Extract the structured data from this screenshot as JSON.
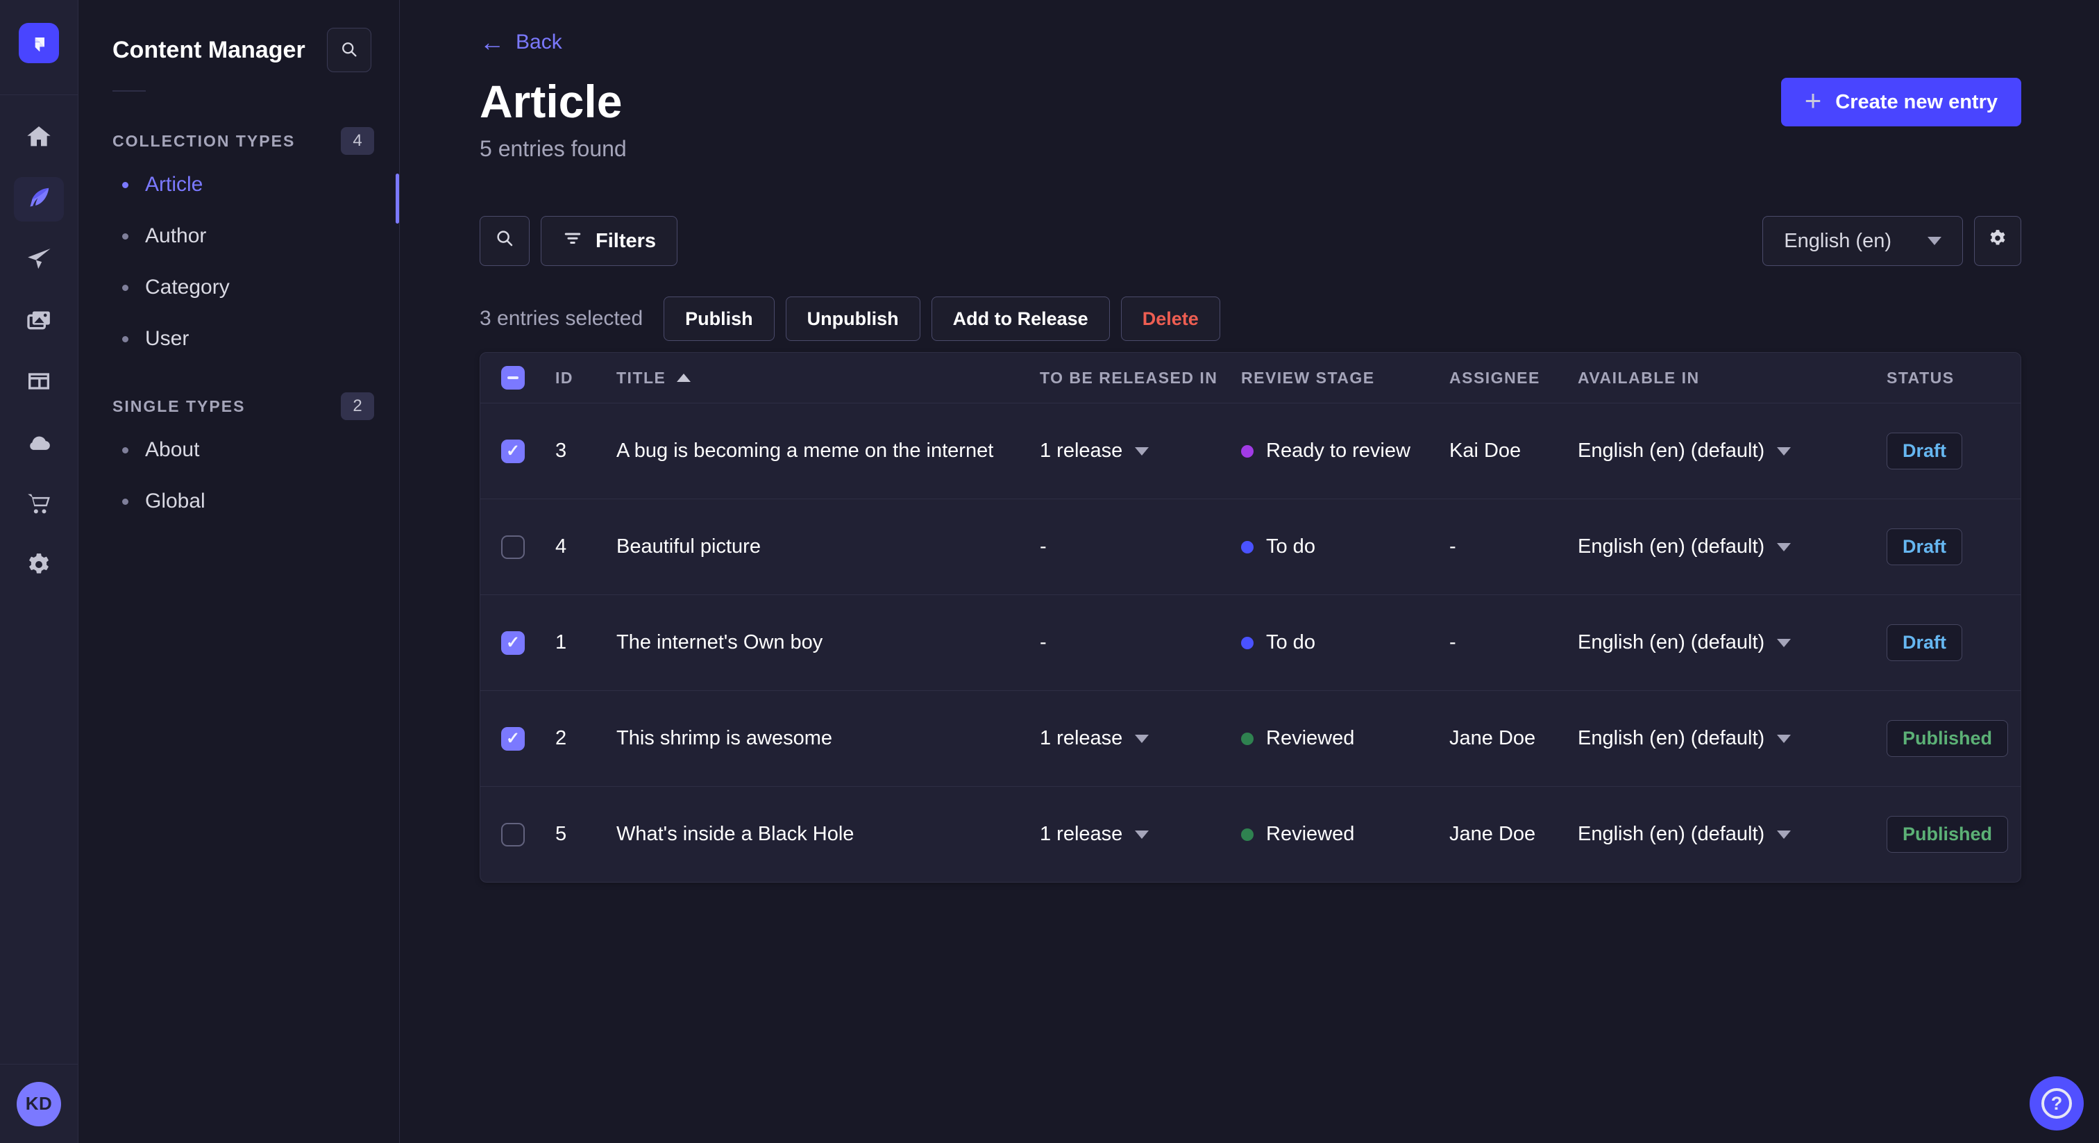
{
  "colors": {
    "accent": "#4945ff",
    "accent_light": "#7b79ff",
    "surface": "#212134",
    "background": "#181826",
    "draft_text": "#66b7f1",
    "published_text": "#5cb176",
    "danger_text": "#ee5e52",
    "stage_ready_to_review": "#a13be6",
    "stage_to_do": "#4a52ff",
    "stage_reviewed": "#2f8250"
  },
  "rail": {
    "avatar_initials": "KD",
    "icons": [
      "strapi-logo",
      "home",
      "content-manager-feather",
      "paper-plane",
      "media-library",
      "content-type-builder-layout",
      "cloud",
      "marketplace-cart",
      "settings-gear"
    ]
  },
  "subnav": {
    "title": "Content Manager",
    "sections": [
      {
        "label": "COLLECTION TYPES",
        "count": "4",
        "items": [
          {
            "label": "Article"
          },
          {
            "label": "Author"
          },
          {
            "label": "Category"
          },
          {
            "label": "User"
          }
        ]
      },
      {
        "label": "SINGLE TYPES",
        "count": "2",
        "items": [
          {
            "label": "About"
          },
          {
            "label": "Global"
          }
        ]
      }
    ]
  },
  "header": {
    "back": "Back",
    "title": "Article",
    "subtitle": "5 entries found",
    "plus": "+",
    "create": "Create new entry"
  },
  "toolbar": {
    "filters": "Filters",
    "locale": "English (en)"
  },
  "selection": {
    "label": "3 entries selected",
    "publish": "Publish",
    "unpublish": "Unpublish",
    "add_to_release": "Add to Release",
    "delete": "Delete"
  },
  "table": {
    "headers": {
      "id": "ID",
      "title": "TITLE",
      "release": "TO BE RELEASED IN",
      "stage": "REVIEW STAGE",
      "assignee": "ASSIGNEE",
      "available": "AVAILABLE IN",
      "status": "STATUS"
    },
    "rows": [
      {
        "checked": true,
        "id": "3",
        "title": "A bug is becoming a meme on the internet",
        "release": "1 release",
        "stage": "Ready to review",
        "stage_color": "#a13be6",
        "assignee": "Kai Doe",
        "available": "English (en) (default)",
        "status": "Draft"
      },
      {
        "checked": false,
        "id": "4",
        "title": "Beautiful picture",
        "release": "-",
        "stage": "To do",
        "stage_color": "#4a52ff",
        "assignee": "-",
        "available": "English (en) (default)",
        "status": "Draft"
      },
      {
        "checked": true,
        "id": "1",
        "title": "The internet's Own boy",
        "release": "-",
        "stage": "To do",
        "stage_color": "#4a52ff",
        "assignee": "-",
        "available": "English (en) (default)",
        "status": "Draft"
      },
      {
        "checked": true,
        "id": "2",
        "title": "This shrimp is awesome",
        "release": "1 release",
        "stage": "Reviewed",
        "stage_color": "#2f8250",
        "assignee": "Jane Doe",
        "available": "English (en) (default)",
        "status": "Published"
      },
      {
        "checked": false,
        "id": "5",
        "title": "What's inside a Black Hole",
        "release": "1 release",
        "stage": "Reviewed",
        "stage_color": "#2f8250",
        "assignee": "Jane Doe",
        "available": "English (en) (default)",
        "status": "Published"
      }
    ]
  },
  "fab": {
    "help": "?"
  }
}
